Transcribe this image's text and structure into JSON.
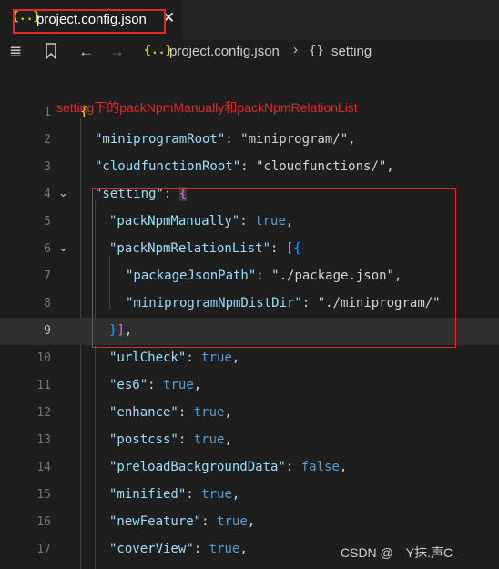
{
  "tab": {
    "icon": "{..}",
    "title": "project.config.json",
    "close": "✕"
  },
  "toolbar": {
    "list_icon": "≣",
    "bookmark_icon": "🔖",
    "back_icon": "←",
    "forward_icon": "→"
  },
  "breadcrumb": {
    "file_icon": "{..}",
    "file": "project.config.json",
    "separator": "›",
    "object_icon": "{}",
    "section": "setting"
  },
  "annotation": "setting下的packNpmManually和packNpmRelationList",
  "watermark": "CSDN @—Y抹.声C—",
  "colors": {
    "annotation_red": "#e02a2a",
    "key": "#9cdcfe",
    "string": "#ce9178",
    "boolean": "#569cd6"
  },
  "lines": [
    {
      "n": "1",
      "text": "{"
    },
    {
      "n": "2",
      "text": "\"miniprogramRoot\": \"miniprogram/\","
    },
    {
      "n": "3",
      "text": "\"cloudfunctionRoot\": \"cloudfunctions/\","
    },
    {
      "n": "4",
      "text": "\"setting\": {"
    },
    {
      "n": "5",
      "text": "\"packNpmManually\": true,"
    },
    {
      "n": "6",
      "text": "\"packNpmRelationList\": [{"
    },
    {
      "n": "7",
      "text": "\"packageJsonPath\": \"./package.json\","
    },
    {
      "n": "8",
      "text": "\"miniprogramNpmDistDir\": \"./miniprogram/\""
    },
    {
      "n": "9",
      "text": "}],"
    },
    {
      "n": "10",
      "text": "\"urlCheck\": true,"
    },
    {
      "n": "11",
      "text": "\"es6\": true,"
    },
    {
      "n": "12",
      "text": "\"enhance\": true,"
    },
    {
      "n": "13",
      "text": "\"postcss\": true,"
    },
    {
      "n": "14",
      "text": "\"preloadBackgroundData\": false,"
    },
    {
      "n": "15",
      "text": "\"minified\": true,"
    },
    {
      "n": "16",
      "text": "\"newFeature\": true,"
    },
    {
      "n": "17",
      "text": "\"coverView\": true,"
    }
  ]
}
